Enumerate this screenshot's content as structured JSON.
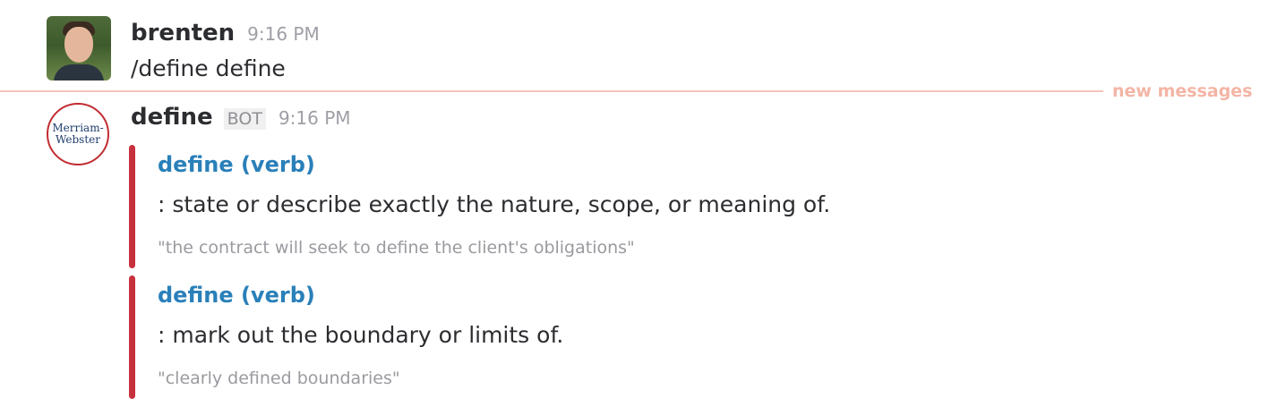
{
  "messages": [
    {
      "author": "brenten",
      "time": "9:16 PM",
      "text": "/define define"
    },
    {
      "author": "define",
      "badge": "BOT",
      "time": "9:16 PM",
      "avatar_text": [
        "Merriam-",
        "Webster"
      ],
      "attachments": [
        {
          "title": "define (verb)",
          "definition": ": state or describe exactly the nature, scope, or meaning of.",
          "example": "\"the contract will seek to define the client's obligations\""
        },
        {
          "title": "define (verb)",
          "definition": ": mark out the boundary or limits of.",
          "example": "\"clearly defined boundaries\""
        }
      ]
    }
  ],
  "divider": {
    "label": "new messages"
  },
  "colors": {
    "link": "#2a80b9",
    "attachment_bar": "#c7303d",
    "divider": "#f3c5b8",
    "divider_label": "#f3b5a5"
  }
}
